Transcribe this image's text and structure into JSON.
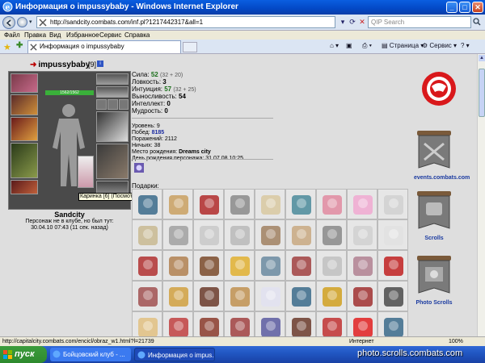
{
  "window": {
    "title": "Информация о impussybaby - Windows Internet Explorer",
    "min": "_",
    "max": "□",
    "close": "✕"
  },
  "address": {
    "url": "http://sandcity.combats.com/inf.pl?1217442317&all=1",
    "search_placeholder": "QIP Search"
  },
  "menu": [
    "Файл",
    "Правка",
    "Вид",
    "Избранное",
    "Сервис",
    "Справка"
  ],
  "tab": {
    "label": "Информация о impussybaby"
  },
  "commands": {
    "page": "Страница",
    "service": "Сервис"
  },
  "character": {
    "nick": "impussybaby",
    "level": "[9]",
    "flag": "i",
    "hp": "1562/1562",
    "city": "Sandcity",
    "last_seen_line1": "Персонаж не в клубе, но был тут:",
    "last_seen_line2": "30.04.10 07:43 (11 сек. назад)",
    "tooltip": "Каринка [6] (Посмотреть образ)"
  },
  "stats": [
    {
      "label": "Сила:",
      "value": "52",
      "extra": "(32 + 20)"
    },
    {
      "label": "Ловкость:",
      "value": "3",
      "extra": ""
    },
    {
      "label": "Интуиция:",
      "value": "57",
      "extra": "(32 + 25)"
    },
    {
      "label": "Выносливость:",
      "value": "54",
      "extra": ""
    },
    {
      "label": "Интеллект:",
      "value": "0",
      "extra": ""
    },
    {
      "label": "Мудрость:",
      "value": "0",
      "extra": ""
    }
  ],
  "info": {
    "level": {
      "label": "Уровень:",
      "value": "9"
    },
    "wins": {
      "label": "Побед:",
      "value": "8185"
    },
    "losses": {
      "label": "Поражений:",
      "value": "2112"
    },
    "draws": {
      "label": "Ничьих:",
      "value": "38"
    },
    "birthplace": {
      "label": "Место рождения:",
      "value": "Dreams city"
    },
    "birthday": {
      "label": "День рождения персонажа:",
      "value": "31.07.08 10:25"
    }
  },
  "gifts_label": "Подарки:",
  "right_banners": [
    {
      "label": "events.combats.com",
      "banner_word": "events"
    },
    {
      "label": "Scrolls",
      "banner_word": "Scrolls"
    },
    {
      "label": "Photo Scrolls",
      "banner_word": "photo"
    }
  ],
  "status": {
    "url": "http://capitalcity.combats.com/encicl/obraz_w1.html?l=21739",
    "zone": "Интернет",
    "zoom": "100%"
  },
  "taskbar": {
    "start": "пуск",
    "task1": "Бойцовский клуб - ...",
    "task2": "Информация о impus...",
    "watermark": "photo.scrolls.combats.com"
  }
}
